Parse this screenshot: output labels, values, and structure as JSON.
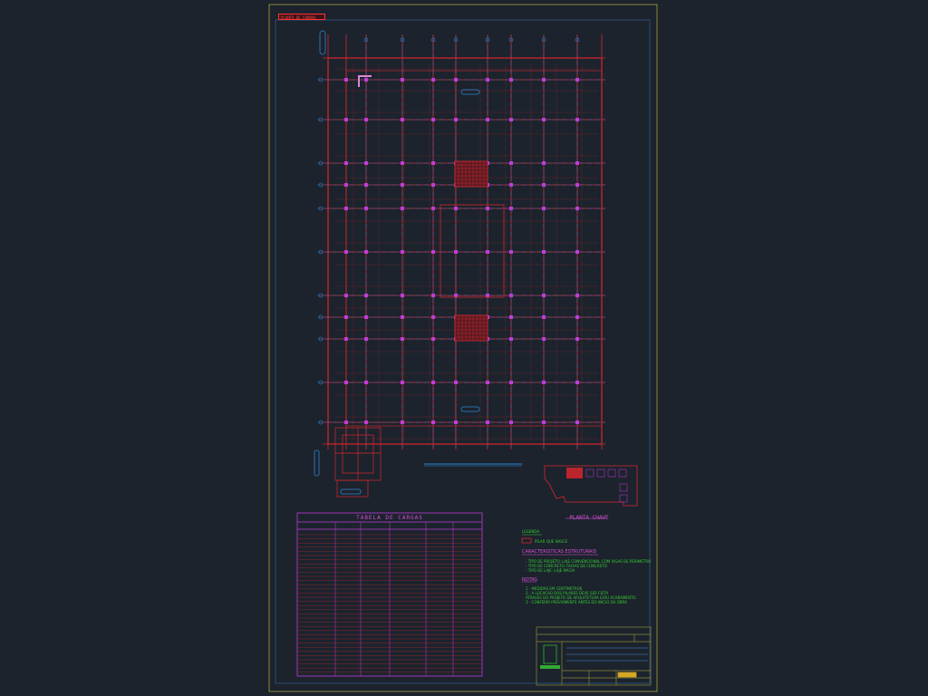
{
  "drawing": {
    "title_tag": "PLANTA DE FORMAS",
    "plan_caption": "",
    "location_title": "PLANTA CHAVE",
    "location_subtitle": "",
    "table_title": "TABELA DE CARGAS",
    "legend_title": "LEGENDA",
    "legend_item": "PILAR QUE NASCE",
    "specs_title": "CARACTERISTICAS ESTRUTURAIS",
    "specs_lines": [
      "- TIPO DE PROJETO: LAJE CONVENCIONAL COM VIGAS DE PERIMETRO",
      "- TIPO DE CONCRETO: FAIXAS DE CONCRETO",
      "- TIPO DE LAJE: LAJE MACIA"
    ],
    "notes_title": "NOTAS",
    "notes_lines": [
      "1 - MEDIDAS EM CENTIMETROS",
      "2 - A LOCACAO DOS PILARES DEVE SER FEITA",
      "    ATRAVES DO PROJETO DE ARQUITETURA E/OU ACABAMENTO",
      "3 - CONFERIR PREVIAMENTE ANTES DO INICIO DA OBRA"
    ],
    "colors": {
      "background": "#1c232d",
      "frame": "#8a8a35",
      "beam": "#d6262e",
      "column": "#c23bd8",
      "axis": "#2f86d6",
      "text_green": "#33cc33"
    }
  }
}
